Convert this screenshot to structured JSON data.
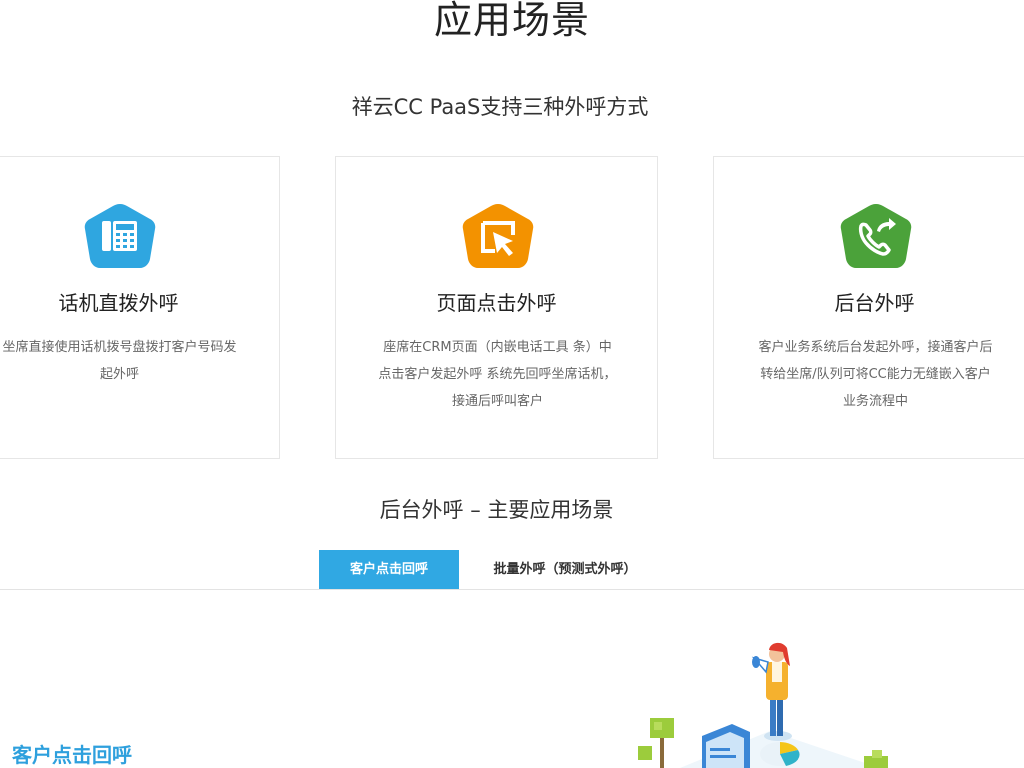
{
  "page": {
    "title": "应用场景",
    "subtitle": "祥云CC PaaS支持三种外呼方式"
  },
  "cards": [
    {
      "icon": "desk-phone-icon",
      "icon_color": "#2fa6e0",
      "title": "话机直拨外呼",
      "desc_lines": [
        "坐席直接使用话机拨号盘拨打客户号码发",
        "起外呼"
      ]
    },
    {
      "icon": "click-cursor-icon",
      "icon_color": "#f39200",
      "title": "页面点击外呼",
      "desc_lines": [
        "座席在CRM页面（内嵌电话工具 条）中",
        "点击客户发起外呼 系统先回呼坐席话机，",
        "接通后呼叫客户"
      ]
    },
    {
      "icon": "phone-transfer-icon",
      "icon_color": "#4ba23a",
      "title": "后台外呼",
      "desc_lines": [
        "客户业务系统后台发起外呼，接通客户后",
        "转给坐席/队列可将CC能力无缝嵌入客户",
        "业务流程中"
      ]
    }
  ],
  "section2": {
    "title": "后台外呼 – 主要应用场景",
    "tabs": [
      {
        "label": "客户点击回呼",
        "active": true
      },
      {
        "label": "批量外呼（预测式外呼）",
        "active": false
      }
    ],
    "scene_title": "客户点击回呼"
  },
  "colors": {
    "accent": "#30a8e3",
    "scene_title": "#2ea0dd"
  }
}
